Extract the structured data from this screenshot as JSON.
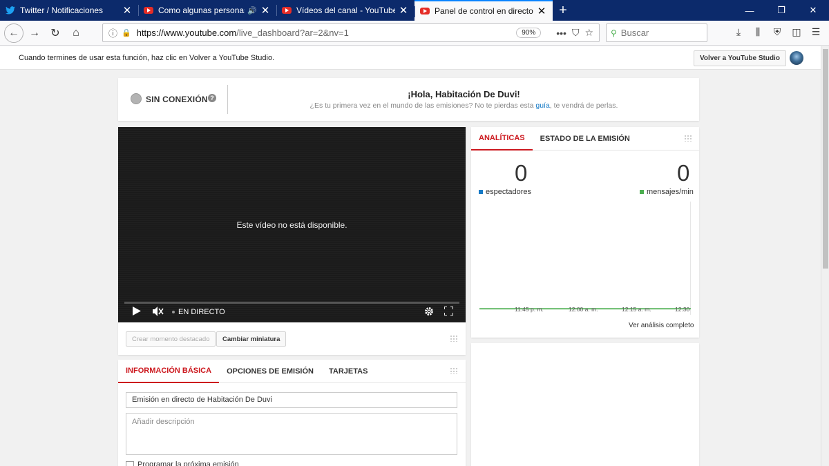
{
  "browser": {
    "tabs": [
      {
        "title": "Twitter / Notificaciones",
        "favicon": "twitter-bird-icon",
        "active": false
      },
      {
        "title": "Como algunas personas pre",
        "favicon": "youtube-icon",
        "active": false,
        "playing_audio": true
      },
      {
        "title": "Vídeos del canal - YouTube Stu",
        "favicon": "youtube-icon",
        "active": false
      },
      {
        "title": "Panel de control en directo - Yo",
        "favicon": "youtube-icon",
        "active": true
      }
    ],
    "new_tab": "+",
    "url_host": "https://www.youtube.com",
    "url_path": "/live_dashboard?ar=2&nv=1",
    "zoom": "90%",
    "search_placeholder": "Buscar",
    "colors": {
      "tabstrip": "#0c2a6b",
      "active_tab_accent": "#0a84ff"
    }
  },
  "page": {
    "notice": "Cuando termines de usar esta función, haz clic en Volver a YouTube Studio.",
    "return_button": "Volver a YouTube Studio",
    "status": {
      "label": "SIN CONEXIÓN",
      "greeting": "¡Hola, Habitación De Duvi!",
      "sub_before": "¿Es tu primera vez en el mundo de las emisiones? No te pierdas esta ",
      "sub_link": "guía",
      "sub_after": ", te vendrá de perlas."
    },
    "player": {
      "message": "Este vídeo no está disponible.",
      "live_label": "EN DIRECTO",
      "highlight_button": "Crear momento destacado",
      "thumbnail_button": "Cambiar miniatura"
    },
    "analytics": {
      "tabs": [
        "ANALÍTICAS",
        "ESTADO DE LA EMISIÓN"
      ],
      "viewers_value": "0",
      "viewers_label": "espectadores",
      "messages_value": "0",
      "messages_label": "mensajes/min",
      "time_ticks": [
        "11:45 p. m.",
        "12:00 a. m.",
        "12:15 a. m.",
        "12:30"
      ],
      "full_link": "Ver análisis completo",
      "colors": {
        "viewers": "#167ac6",
        "messages": "#4caf50",
        "accent": "#cc181e"
      }
    },
    "info": {
      "tabs": [
        "INFORMACIÓN BÁSICA",
        "OPCIONES DE EMISIÓN",
        "TARJETAS"
      ],
      "title_value": "Emisión en directo de Habitación De Duvi",
      "description_placeholder": "Añadir descripción",
      "schedule_label": "Programar la próxima emisión"
    }
  }
}
